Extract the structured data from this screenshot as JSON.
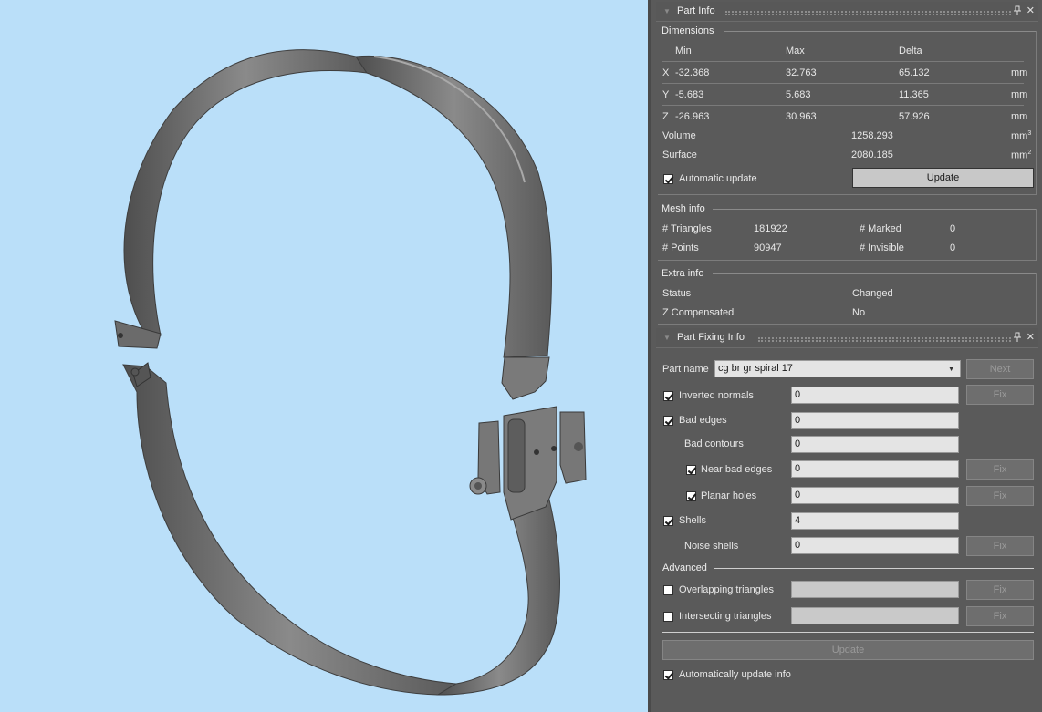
{
  "part_info": {
    "title": "Part Info",
    "dimensions_label": "Dimensions",
    "col_min": "Min",
    "col_max": "Max",
    "col_delta": "Delta",
    "rows": [
      {
        "axis": "X",
        "min": "-32.368",
        "max": "32.763",
        "delta": "65.132",
        "unit": "mm"
      },
      {
        "axis": "Y",
        "min": "-5.683",
        "max": "5.683",
        "delta": "11.365",
        "unit": "mm"
      },
      {
        "axis": "Z",
        "min": "-26.963",
        "max": "30.963",
        "delta": "57.926",
        "unit": "mm"
      }
    ],
    "volume_label": "Volume",
    "volume_value": "1258.293",
    "volume_unit": "mm",
    "volume_exp": "3",
    "surface_label": "Surface",
    "surface_value": "2080.185",
    "surface_unit": "mm",
    "surface_exp": "2",
    "auto_update_label": "Automatic update",
    "auto_update_checked": true,
    "update_button": "Update",
    "mesh_info_label": "Mesh info",
    "triangles_label": "# Triangles",
    "triangles_value": "181922",
    "marked_label": "# Marked",
    "marked_value": "0",
    "points_label": "# Points",
    "points_value": "90947",
    "invisible_label": "# Invisible",
    "invisible_value": "0",
    "extra_info_label": "Extra info",
    "status_label": "Status",
    "status_value": "Changed",
    "zcomp_label": "Z Compensated",
    "zcomp_value": "No"
  },
  "part_fixing": {
    "title": "Part Fixing Info",
    "part_name_label": "Part name",
    "part_name_value": "cg br gr spiral 17",
    "next_button": "Next",
    "fix_label": "Fix",
    "inverted_normals_label": "Inverted normals",
    "inverted_normals_value": "0",
    "bad_edges_label": "Bad edges",
    "bad_edges_value": "0",
    "bad_contours_label": "Bad contours",
    "bad_contours_value": "0",
    "near_bad_edges_label": "Near bad edges",
    "near_bad_edges_value": "0",
    "planar_holes_label": "Planar holes",
    "planar_holes_value": "0",
    "shells_label": "Shells",
    "shells_value": "4",
    "noise_shells_label": "Noise shells",
    "noise_shells_value": "0",
    "advanced_label": "Advanced",
    "overlapping_label": "Overlapping triangles",
    "intersecting_label": "Intersecting triangles",
    "update_button": "Update",
    "auto_update_info_label": "Automatically update info"
  },
  "colors": {
    "viewport_bg": "#badff9",
    "model_gray": "#6f6f6f",
    "panel_bg": "#5a5a5a"
  }
}
